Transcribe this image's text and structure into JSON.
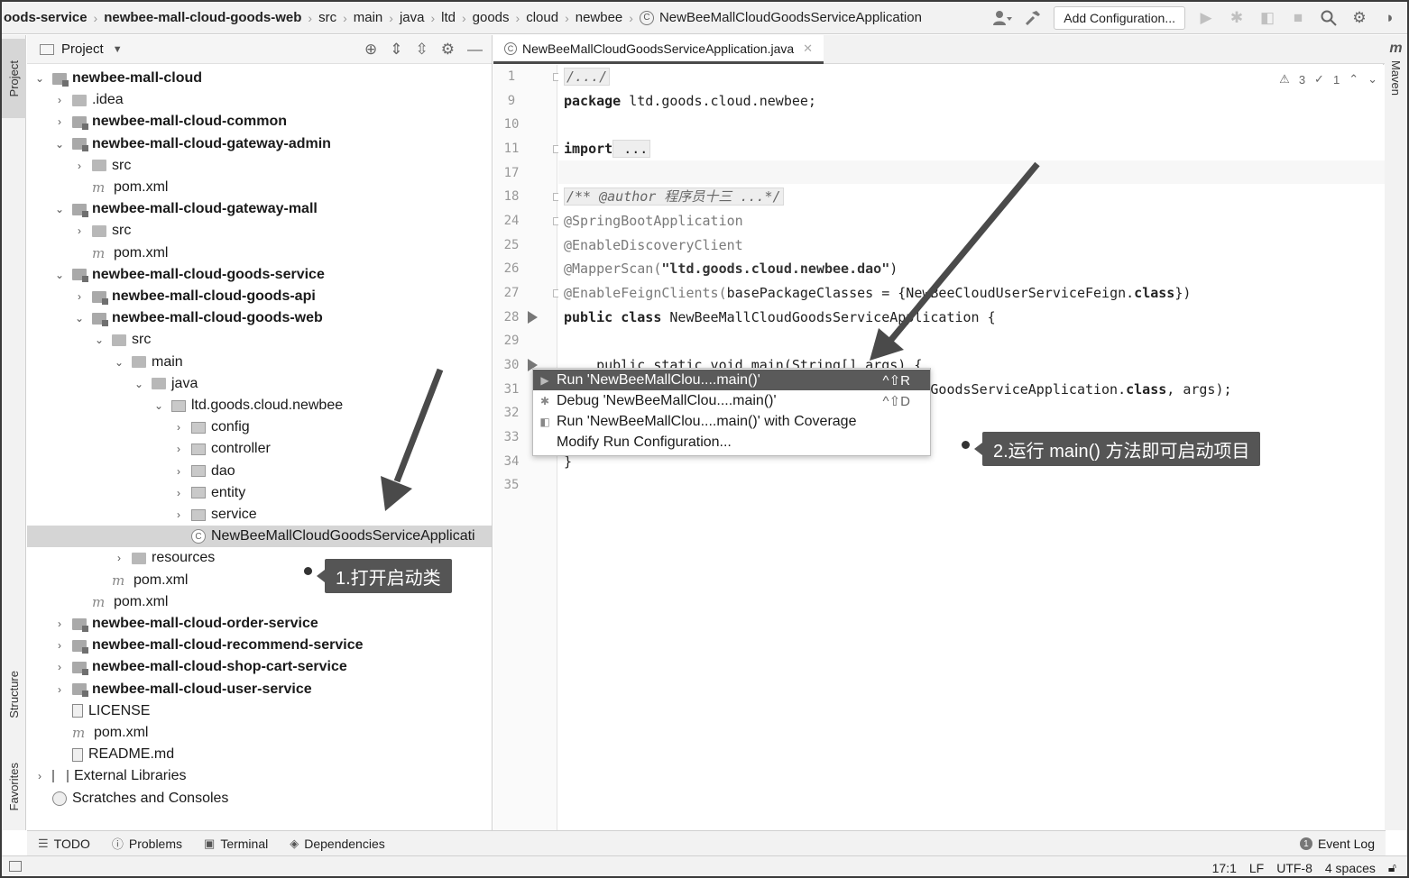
{
  "breadcrumb": [
    "oods-service",
    "newbee-mall-cloud-goods-web",
    "src",
    "main",
    "java",
    "ltd",
    "goods",
    "cloud",
    "newbee",
    "NewBeeMallCloudGoodsServiceApplication"
  ],
  "toolbar": {
    "add_configuration": "Add Configuration..."
  },
  "left_strip": {
    "project": "Project",
    "structure": "Structure",
    "favorites": "Favorites"
  },
  "right_strip": {
    "maven_icon": "m",
    "maven": "Maven"
  },
  "project_panel": {
    "title": "Project",
    "tree": [
      {
        "label": "newbee-mall-cloud",
        "bold": true,
        "icon": "module",
        "arrow": "⌄"
      },
      {
        "label": ".idea",
        "bold": false,
        "icon": "folder",
        "arrow": "›"
      },
      {
        "label": "newbee-mall-cloud-common",
        "bold": true,
        "icon": "module",
        "arrow": "›"
      },
      {
        "label": "newbee-mall-cloud-gateway-admin",
        "bold": true,
        "icon": "module",
        "arrow": "⌄"
      },
      {
        "label": "src",
        "bold": false,
        "icon": "folder",
        "arrow": "›"
      },
      {
        "label": "pom.xml",
        "bold": false,
        "icon": "maven",
        "arrow": ""
      },
      {
        "label": "newbee-mall-cloud-gateway-mall",
        "bold": true,
        "icon": "module",
        "arrow": "⌄"
      },
      {
        "label": "src",
        "bold": false,
        "icon": "folder",
        "arrow": "›"
      },
      {
        "label": "pom.xml",
        "bold": false,
        "icon": "maven",
        "arrow": ""
      },
      {
        "label": "newbee-mall-cloud-goods-service",
        "bold": true,
        "icon": "module",
        "arrow": "⌄"
      },
      {
        "label": "newbee-mall-cloud-goods-api",
        "bold": true,
        "icon": "module",
        "arrow": "›"
      },
      {
        "label": "newbee-mall-cloud-goods-web",
        "bold": true,
        "icon": "module",
        "arrow": "⌄"
      },
      {
        "label": "src",
        "bold": false,
        "icon": "folder",
        "arrow": "⌄"
      },
      {
        "label": "main",
        "bold": false,
        "icon": "folder",
        "arrow": "⌄"
      },
      {
        "label": "java",
        "bold": false,
        "icon": "folder",
        "arrow": "⌄"
      },
      {
        "label": "ltd.goods.cloud.newbee",
        "bold": false,
        "icon": "pkg",
        "arrow": "⌄"
      },
      {
        "label": "config",
        "bold": false,
        "icon": "pkg",
        "arrow": "›"
      },
      {
        "label": "controller",
        "bold": false,
        "icon": "pkg",
        "arrow": "›"
      },
      {
        "label": "dao",
        "bold": false,
        "icon": "pkg",
        "arrow": "›"
      },
      {
        "label": "entity",
        "bold": false,
        "icon": "pkg",
        "arrow": "›"
      },
      {
        "label": "service",
        "bold": false,
        "icon": "pkg",
        "arrow": "›"
      },
      {
        "label": "NewBeeMallCloudGoodsServiceApplicati",
        "bold": false,
        "icon": "cls",
        "arrow": ""
      },
      {
        "label": "resources",
        "bold": false,
        "icon": "folder",
        "arrow": "›"
      },
      {
        "label": "pom.xml",
        "bold": false,
        "icon": "maven",
        "arrow": ""
      },
      {
        "label": "pom.xml",
        "bold": false,
        "icon": "maven",
        "arrow": ""
      },
      {
        "label": "newbee-mall-cloud-order-service",
        "bold": true,
        "icon": "module",
        "arrow": "›"
      },
      {
        "label": "newbee-mall-cloud-recommend-service",
        "bold": true,
        "icon": "module",
        "arrow": "›"
      },
      {
        "label": "newbee-mall-cloud-shop-cart-service",
        "bold": true,
        "icon": "module",
        "arrow": "›"
      },
      {
        "label": "newbee-mall-cloud-user-service",
        "bold": true,
        "icon": "module",
        "arrow": "›"
      },
      {
        "label": "LICENSE",
        "bold": false,
        "icon": "file",
        "arrow": ""
      },
      {
        "label": "pom.xml",
        "bold": false,
        "icon": "maven",
        "arrow": ""
      },
      {
        "label": "README.md",
        "bold": false,
        "icon": "file",
        "arrow": ""
      },
      {
        "label": "External Libraries",
        "bold": false,
        "icon": "libs",
        "arrow": "›"
      },
      {
        "label": "Scratches and Consoles",
        "bold": false,
        "icon": "scratch",
        "arrow": ""
      }
    ]
  },
  "editor": {
    "tab_label": "NewBeeMallCloudGoodsServiceApplication.java",
    "inspections": {
      "warnings": "3",
      "weak_warnings": "1"
    },
    "line_numbers": [
      "1",
      "9",
      "10",
      "11",
      "17",
      "18",
      "24",
      "25",
      "26",
      "27",
      "28",
      "29",
      "30",
      "31",
      "32",
      "33",
      "34",
      "35"
    ],
    "lines": {
      "l1": "/.../",
      "l9_kw": "package",
      "l9_rest": " ltd.goods.cloud.newbee;",
      "l11_kw": "import",
      "l11_rest": " ...",
      "l18": "/** @author 程序员十三 ...*/",
      "l24": "@SpringBootApplication",
      "l25": "@EnableDiscoveryClient",
      "l26_ann": "@MapperScan(",
      "l26_str": "\"ltd.goods.cloud.newbee.dao\"",
      "l26_end": ")",
      "l27_ann": "@EnableFeignClients(",
      "l27_rest": "basePackageClasses = {NewBeeCloudUserServiceFeign.",
      "l27_kw": "class",
      "l27_end": "})",
      "l28_kw": "public class",
      "l28_rest": " NewBeeMallCloudGoodsServiceApplication {",
      "l30": "    public static void main(String[] args) {",
      "l31_rest": "        SpringApplication.run(NewBeeMallCloudGoodsServiceApplication.",
      "l31_kw": "class",
      "l31_end": ", args);",
      "l34": "}"
    }
  },
  "popup": [
    {
      "label": "Run 'NewBeeMallClou....main()'",
      "shortcut": "^⇧R",
      "icon": "▶"
    },
    {
      "label": "Debug 'NewBeeMallClou....main()'",
      "shortcut": "^⇧D",
      "icon": "✱"
    },
    {
      "label": "Run 'NewBeeMallClou....main()' with Coverage",
      "shortcut": "",
      "icon": "◧"
    },
    {
      "label": "Modify Run Configuration...",
      "shortcut": "",
      "icon": ""
    }
  ],
  "callouts": {
    "step1": "1.打开启动类",
    "step2": "2.运行 main() 方法即可启动项目"
  },
  "bottom_tabs": [
    "TODO",
    "Problems",
    "Terminal",
    "Dependencies"
  ],
  "event_log": {
    "count": "1",
    "label": "Event Log"
  },
  "status": {
    "position": "17:1",
    "line_sep": "LF",
    "encoding": "UTF-8",
    "indent": "4 spaces"
  }
}
